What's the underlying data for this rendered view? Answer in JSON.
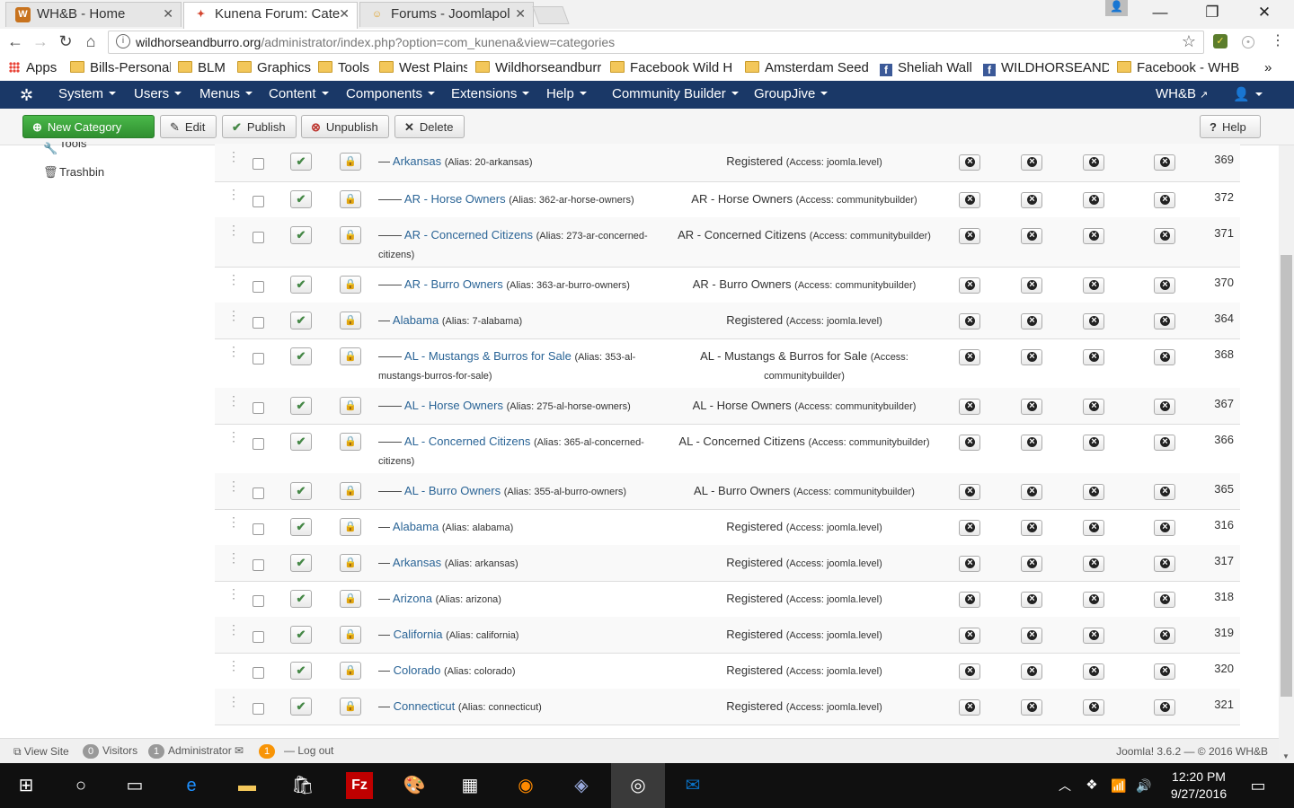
{
  "browser": {
    "tabs": [
      {
        "label": "WH&B - Home",
        "favicon": "W"
      },
      {
        "label": "Kunena Forum: Cate",
        "favicon": "✦"
      },
      {
        "label": "Forums - Joomlapol",
        "favicon": "☺"
      }
    ],
    "url_host": "wildhorseandburro.org",
    "url_path": "/administrator/index.php?option=com_kunena&view=categories",
    "bookmarks": [
      "Apps",
      "Bills-Personal",
      "BLM",
      "Graphics",
      "Tools",
      "West Plains",
      "Wildhorseandburr",
      "Facebook Wild H",
      "Amsterdam Seed",
      "Sheliah Wall",
      "WILDHORSEAND",
      "Facebook - WHB"
    ],
    "more": "»"
  },
  "nav": {
    "menus": [
      "System",
      "Users",
      "Menus",
      "Content",
      "Components",
      "Extensions",
      "Help",
      "Community Builder",
      "GroupJive"
    ],
    "site_link": "WH&B",
    "user_icon": "user-icon"
  },
  "toolbar": {
    "new": "New Category",
    "edit": "Edit",
    "publish": "Publish",
    "unpublish": "Unpublish",
    "delete": "Delete",
    "help": "Help"
  },
  "sidebar": {
    "items": [
      "Tools",
      "Trashbin"
    ]
  },
  "rows": [
    {
      "dash": "—",
      "name": "Arkansas",
      "alias": "(Alias: 20-arkansas)",
      "access": "Registered",
      "acc": "(Access: joomla.level)",
      "id": "369"
    },
    {
      "dash": "——",
      "name": "AR - Horse Owners",
      "alias": "(Alias: 362-ar-horse-owners)",
      "access": "AR - Horse Owners",
      "acc": "(Access: communitybuilder)",
      "id": "372"
    },
    {
      "dash": "——",
      "name": "AR - Concerned Citizens",
      "alias": "(Alias: 273-ar-concerned-citizens)",
      "access": "AR - Concerned Citizens",
      "acc": "(Access: communitybuilder)",
      "id": "371"
    },
    {
      "dash": "——",
      "name": "AR - Burro Owners",
      "alias": "(Alias: 363-ar-burro-owners)",
      "access": "AR - Burro Owners",
      "acc": "(Access: communitybuilder)",
      "id": "370"
    },
    {
      "dash": "—",
      "name": "Alabama",
      "alias": "(Alias: 7-alabama)",
      "access": "Registered",
      "acc": "(Access: joomla.level)",
      "id": "364"
    },
    {
      "dash": "——",
      "name": "AL - Mustangs & Burros for Sale",
      "alias": "(Alias: 353-al-mustangs-burros-for-sale)",
      "access": "AL - Mustangs & Burros for Sale",
      "acc": "(Access: communitybuilder)",
      "id": "368"
    },
    {
      "dash": "——",
      "name": "AL - Horse Owners",
      "alias": "(Alias: 275-al-horse-owners)",
      "access": "AL - Horse Owners",
      "acc": "(Access: communitybuilder)",
      "id": "367"
    },
    {
      "dash": "——",
      "name": "AL - Concerned Citizens",
      "alias": "(Alias: 365-al-concerned-citizens)",
      "access": "AL - Concerned Citizens",
      "acc": "(Access: communitybuilder)",
      "id": "366"
    },
    {
      "dash": "——",
      "name": "AL - Burro Owners",
      "alias": "(Alias: 355-al-burro-owners)",
      "access": "AL - Burro Owners",
      "acc": "(Access: communitybuilder)",
      "id": "365"
    },
    {
      "dash": "—",
      "name": "Alabama",
      "alias": "(Alias: alabama)",
      "access": "Registered",
      "acc": "(Access: joomla.level)",
      "id": "316"
    },
    {
      "dash": "—",
      "name": "Arkansas",
      "alias": "(Alias: arkansas)",
      "access": "Registered",
      "acc": "(Access: joomla.level)",
      "id": "317"
    },
    {
      "dash": "—",
      "name": "Arizona",
      "alias": "(Alias: arizona)",
      "access": "Registered",
      "acc": "(Access: joomla.level)",
      "id": "318"
    },
    {
      "dash": "—",
      "name": "California",
      "alias": "(Alias: california)",
      "access": "Registered",
      "acc": "(Access: joomla.level)",
      "id": "319"
    },
    {
      "dash": "—",
      "name": "Colorado",
      "alias": "(Alias: colorado)",
      "access": "Registered",
      "acc": "(Access: joomla.level)",
      "id": "320"
    },
    {
      "dash": "—",
      "name": "Connecticut",
      "alias": "(Alias: connecticut)",
      "access": "Registered",
      "acc": "(Access: joomla.level)",
      "id": "321"
    }
  ],
  "status": {
    "view_site": "View Site",
    "visitors_count": "0",
    "visitors": "Visitors",
    "admin_count": "1",
    "admin": "Administrator",
    "messages_count": "1",
    "logout": "Log out",
    "version": "Joomla! 3.6.2 — © 2016 WH&B"
  },
  "taskbar": {
    "time": "12:20 PM",
    "date": "9/27/2016"
  }
}
